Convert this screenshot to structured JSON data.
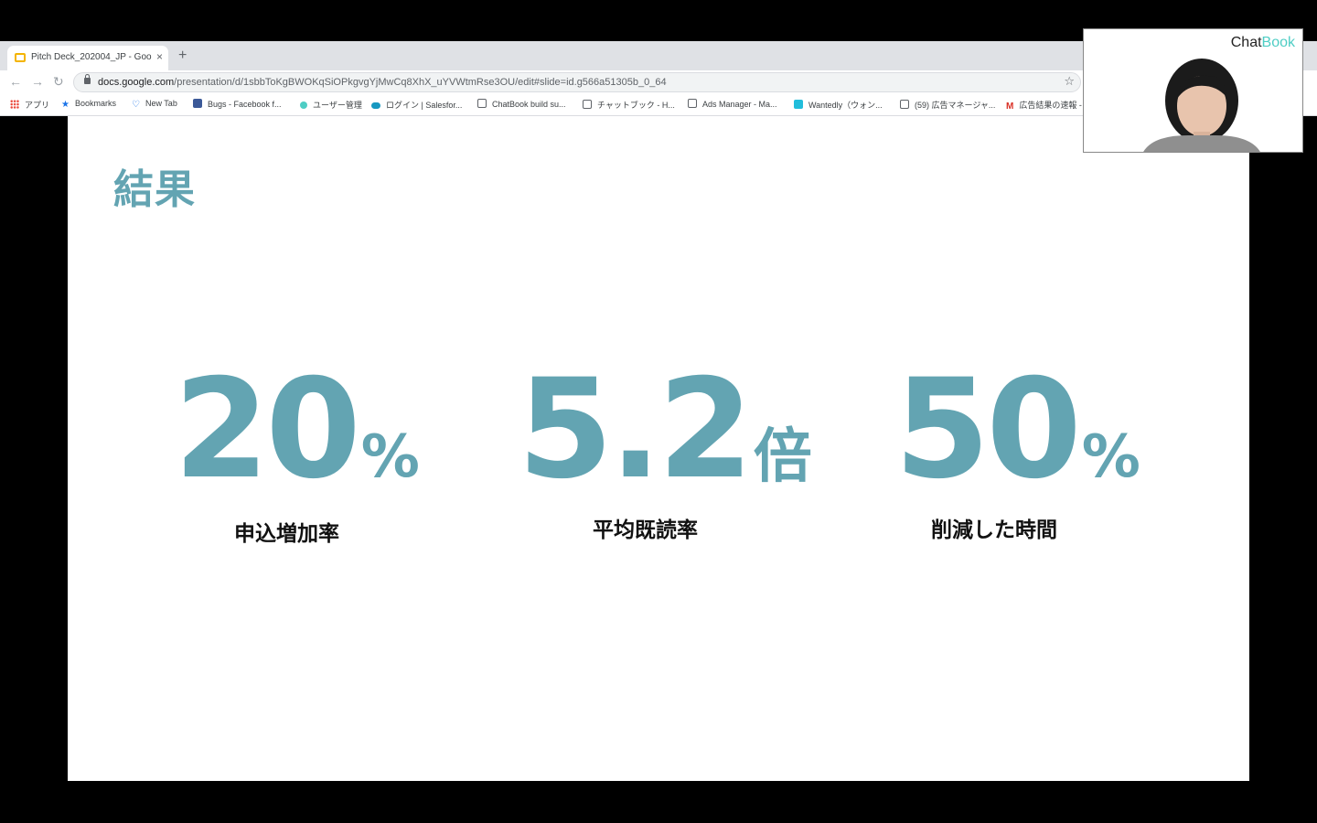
{
  "browser": {
    "tab": {
      "title": "Pitch Deck_202004_JP - Goog",
      "close": "×"
    },
    "new_tab": "+",
    "nav": {
      "back": "←",
      "forward": "→",
      "reload": "↻"
    },
    "url": {
      "domain": "docs.google.com",
      "path": "/presentation/d/1sbbToKgBWOKqSiOPkgvgYjMwCq8XhX_uYVWtmRse3OU/edit#slide=id.g566a51305b_0_64"
    },
    "star": "☆",
    "bookmarks": [
      {
        "label": "アプリ",
        "icon": "apps-grid-icon",
        "color": "#ea4335"
      },
      {
        "label": "Bookmarks",
        "icon": "star-icon",
        "color": "#1a73e8"
      },
      {
        "label": "New Tab",
        "icon": "heart-icon",
        "color": "#1a73e8"
      },
      {
        "label": "Bugs - Facebook f...",
        "icon": "facebook-icon",
        "color": "#3b5998"
      },
      {
        "label": "ユーザー管理",
        "icon": "chat-bubble-icon",
        "color": "#4ecdc4"
      },
      {
        "label": "ログイン | Salesfor...",
        "icon": "cloud-icon",
        "color": "#1798c1"
      },
      {
        "label": "ChatBook build su...",
        "icon": "page-icon",
        "color": "#5f6368"
      },
      {
        "label": "チャットブック - H...",
        "icon": "page-icon",
        "color": "#5f6368"
      },
      {
        "label": "Ads Manager - Ma...",
        "icon": "page-icon",
        "color": "#5f6368"
      },
      {
        "label": "Wantedly（ウォン...",
        "icon": "wantedly-icon",
        "color": "#21bddb"
      },
      {
        "label": "(59) 広告マネージャ...",
        "icon": "page-icon",
        "color": "#5f6368"
      },
      {
        "label": "広告結果の速報 -",
        "icon": "gmail-icon",
        "color": "#d93025"
      }
    ]
  },
  "slide": {
    "title": "結果",
    "accent_color": "#63a4b2",
    "stats": [
      {
        "value": "20",
        "unit": "%",
        "label": "申込増加率"
      },
      {
        "value": "5.2",
        "unit": "倍",
        "label": "平均既読率"
      },
      {
        "value": "50",
        "unit": "%",
        "label": "削減した時間"
      }
    ]
  },
  "webcam": {
    "brand_main": "Chat",
    "brand_accent": "Book"
  }
}
